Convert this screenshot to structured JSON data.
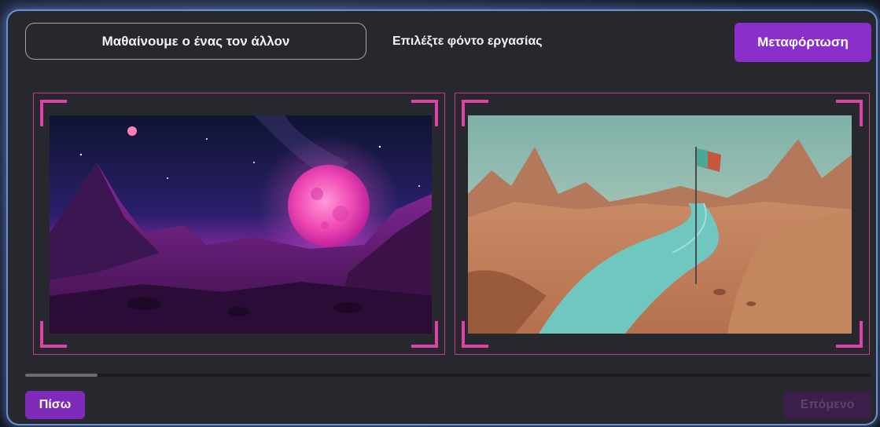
{
  "header": {
    "title": "Μαθαίνουμε ο ένας τον άλλον",
    "section_label": "Επιλέξτε φόντο εργασίας",
    "upload_label": "Μεταφόρτωση"
  },
  "footer": {
    "back_label": "Πίσω",
    "next_label": "Επόμενο"
  },
  "backgrounds": [
    {
      "name": "purple-moon-landscape"
    },
    {
      "name": "desert-river-flag-landscape"
    }
  ],
  "colors": {
    "accent": "#8a2fc9",
    "frame_border": "#c43a93",
    "corner": "#e040a8",
    "panel": "#26282e"
  }
}
